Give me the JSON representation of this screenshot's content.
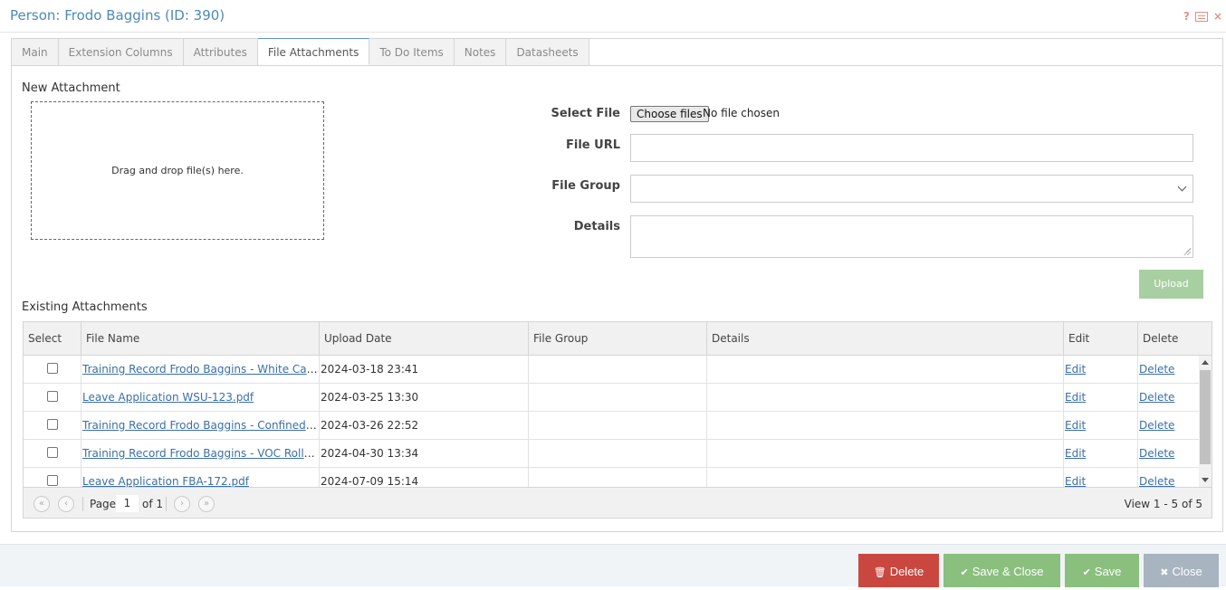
{
  "window": {
    "title": "Person: Frodo Baggins (ID: 390)",
    "help_icon": "?",
    "close_icon": "×"
  },
  "tabs": [
    {
      "label": "Main",
      "active": false
    },
    {
      "label": "Extension Columns",
      "active": false
    },
    {
      "label": "Attributes",
      "active": false
    },
    {
      "label": "File Attachments",
      "active": true
    },
    {
      "label": "To Do Items",
      "active": false
    },
    {
      "label": "Notes",
      "active": false
    },
    {
      "label": "Datasheets",
      "active": false
    }
  ],
  "new_attachment": {
    "heading": "New Attachment",
    "dropzone_text": "Drag and drop file(s) here.",
    "select_file_label": "Select File",
    "choose_files_button": "Choose files",
    "file_status": "No file chosen",
    "file_url_label": "File URL",
    "file_url_value": "",
    "file_group_label": "File Group",
    "file_group_value": "",
    "details_label": "Details",
    "details_value": "",
    "upload_button": "Upload"
  },
  "existing": {
    "heading": "Existing Attachments",
    "columns": [
      "Select",
      "File Name",
      "Upload Date",
      "File Group",
      "Details",
      "Edit",
      "Delete"
    ],
    "rows": [
      {
        "file_name": "Training Record Frodo Baggins - White Card .pdf",
        "upload_date": "2024-03-18 23:41",
        "file_group": "",
        "details": "",
        "edit": "Edit",
        "delete": "Delete"
      },
      {
        "file_name": "Leave Application WSU-123.pdf",
        "upload_date": "2024-03-25 13:30",
        "file_group": "",
        "details": "",
        "edit": "Edit",
        "delete": "Delete"
      },
      {
        "file_name": "Training Record Frodo Baggins - Confined Spa…",
        "upload_date": "2024-03-26 22:52",
        "file_group": "",
        "details": "",
        "edit": "Edit",
        "delete": "Delete"
      },
      {
        "file_name": "Training Record Frodo Baggins - VOC Roller Tic…",
        "upload_date": "2024-04-30 13:34",
        "file_group": "",
        "details": "",
        "edit": "Edit",
        "delete": "Delete"
      },
      {
        "file_name": "Leave Application FBA-172.pdf",
        "upload_date": "2024-07-09 15:14",
        "file_group": "",
        "details": "",
        "edit": "Edit",
        "delete": "Delete"
      }
    ],
    "pager": {
      "page_label": "Page",
      "page_value": "1",
      "of_label": "of 1",
      "view_text": "View 1 - 5 of 5"
    }
  },
  "footer": {
    "delete_button": "Delete",
    "save_close_button": "Save & Close",
    "save_button": "Save",
    "close_button": "Close"
  },
  "colors": {
    "title_blue": "#4d8ab8",
    "link_blue": "#3a6fa8",
    "delete_red": "#c9473f",
    "save_green": "#8bbf7e",
    "close_grey": "#a8b4bf",
    "upload_green_disabled": "#a8cfa1"
  }
}
